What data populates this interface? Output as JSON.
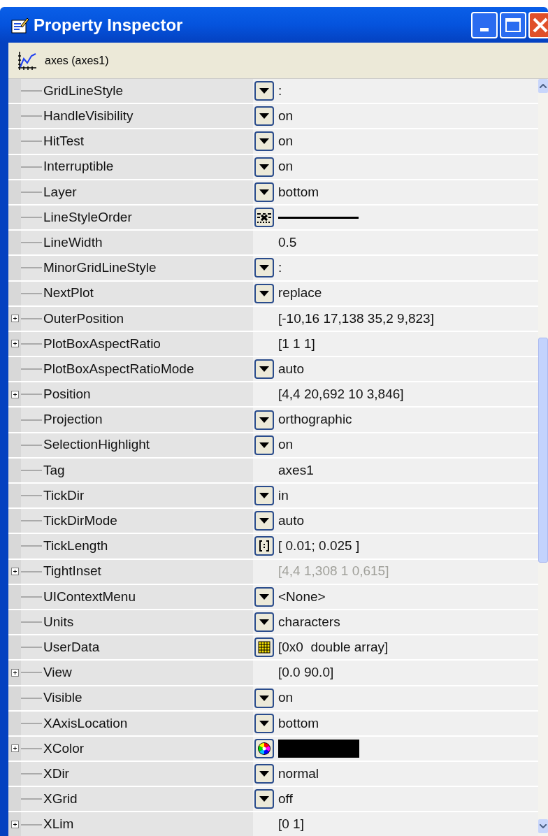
{
  "window": {
    "title": "Property Inspector"
  },
  "object_label": "axes (axes1)",
  "rows": [
    {
      "name": "GridLineStyle",
      "expandable": false,
      "kind": "dropdown",
      "value": ":",
      "disabled": false
    },
    {
      "name": "HandleVisibility",
      "expandable": false,
      "kind": "dropdown",
      "value": "on",
      "disabled": false
    },
    {
      "name": "HitTest",
      "expandable": false,
      "kind": "dropdown",
      "value": "on",
      "disabled": false
    },
    {
      "name": "Interruptible",
      "expandable": false,
      "kind": "dropdown",
      "value": "on",
      "disabled": false
    },
    {
      "name": "Layer",
      "expandable": false,
      "kind": "dropdown",
      "value": "bottom",
      "disabled": false
    },
    {
      "name": "LineStyleOrder",
      "expandable": false,
      "kind": "linestyle",
      "disabled": false
    },
    {
      "name": "LineWidth",
      "expandable": false,
      "kind": "text",
      "value": "0.5",
      "disabled": false
    },
    {
      "name": "MinorGridLineStyle",
      "expandable": false,
      "kind": "dropdown",
      "value": ":",
      "disabled": false
    },
    {
      "name": "NextPlot",
      "expandable": false,
      "kind": "dropdown",
      "value": "replace",
      "disabled": false
    },
    {
      "name": "OuterPosition",
      "expandable": true,
      "kind": "text",
      "value": "[-10,16 17,138 35,2 9,823]",
      "disabled": false
    },
    {
      "name": "PlotBoxAspectRatio",
      "expandable": true,
      "kind": "text",
      "value": "[1 1 1]",
      "disabled": false
    },
    {
      "name": "PlotBoxAspectRatioMode",
      "expandable": false,
      "kind": "dropdown",
      "value": "auto",
      "disabled": false
    },
    {
      "name": "Position",
      "expandable": true,
      "kind": "text",
      "value": "[4,4 20,692 10 3,846]",
      "disabled": false
    },
    {
      "name": "Projection",
      "expandable": false,
      "kind": "dropdown",
      "value": "orthographic",
      "disabled": false
    },
    {
      "name": "SelectionHighlight",
      "expandable": false,
      "kind": "dropdown",
      "value": "on",
      "disabled": false
    },
    {
      "name": "Tag",
      "expandable": false,
      "kind": "text",
      "value": "axes1",
      "disabled": false
    },
    {
      "name": "TickDir",
      "expandable": false,
      "kind": "dropdown",
      "value": "in",
      "disabled": false
    },
    {
      "name": "TickDirMode",
      "expandable": false,
      "kind": "dropdown",
      "value": "auto",
      "disabled": false
    },
    {
      "name": "TickLength",
      "expandable": false,
      "kind": "vector",
      "value": "[ 0.01; 0.025 ]",
      "disabled": false
    },
    {
      "name": "TightInset",
      "expandable": true,
      "kind": "text",
      "value": "[4,4 1,308 1 0,615]",
      "disabled": true
    },
    {
      "name": "UIContextMenu",
      "expandable": false,
      "kind": "dropdown",
      "value": "<None>",
      "disabled": false
    },
    {
      "name": "Units",
      "expandable": false,
      "kind": "dropdown",
      "value": "characters",
      "disabled": false
    },
    {
      "name": "UserData",
      "expandable": false,
      "kind": "matrix",
      "value": "[0x0  double array]",
      "disabled": false
    },
    {
      "name": "View",
      "expandable": true,
      "kind": "text",
      "value": "[0.0 90.0]",
      "disabled": false
    },
    {
      "name": "Visible",
      "expandable": false,
      "kind": "dropdown",
      "value": "on",
      "disabled": false
    },
    {
      "name": "XAxisLocation",
      "expandable": false,
      "kind": "dropdown",
      "value": "bottom",
      "disabled": false
    },
    {
      "name": "XColor",
      "expandable": true,
      "kind": "color",
      "color": "#000000",
      "disabled": false
    },
    {
      "name": "XDir",
      "expandable": false,
      "kind": "dropdown",
      "value": "normal",
      "disabled": false
    },
    {
      "name": "XGrid",
      "expandable": false,
      "kind": "dropdown",
      "value": "off",
      "disabled": false
    },
    {
      "name": "XLim",
      "expandable": true,
      "kind": "text",
      "value": "[0 1]",
      "disabled": false
    }
  ]
}
